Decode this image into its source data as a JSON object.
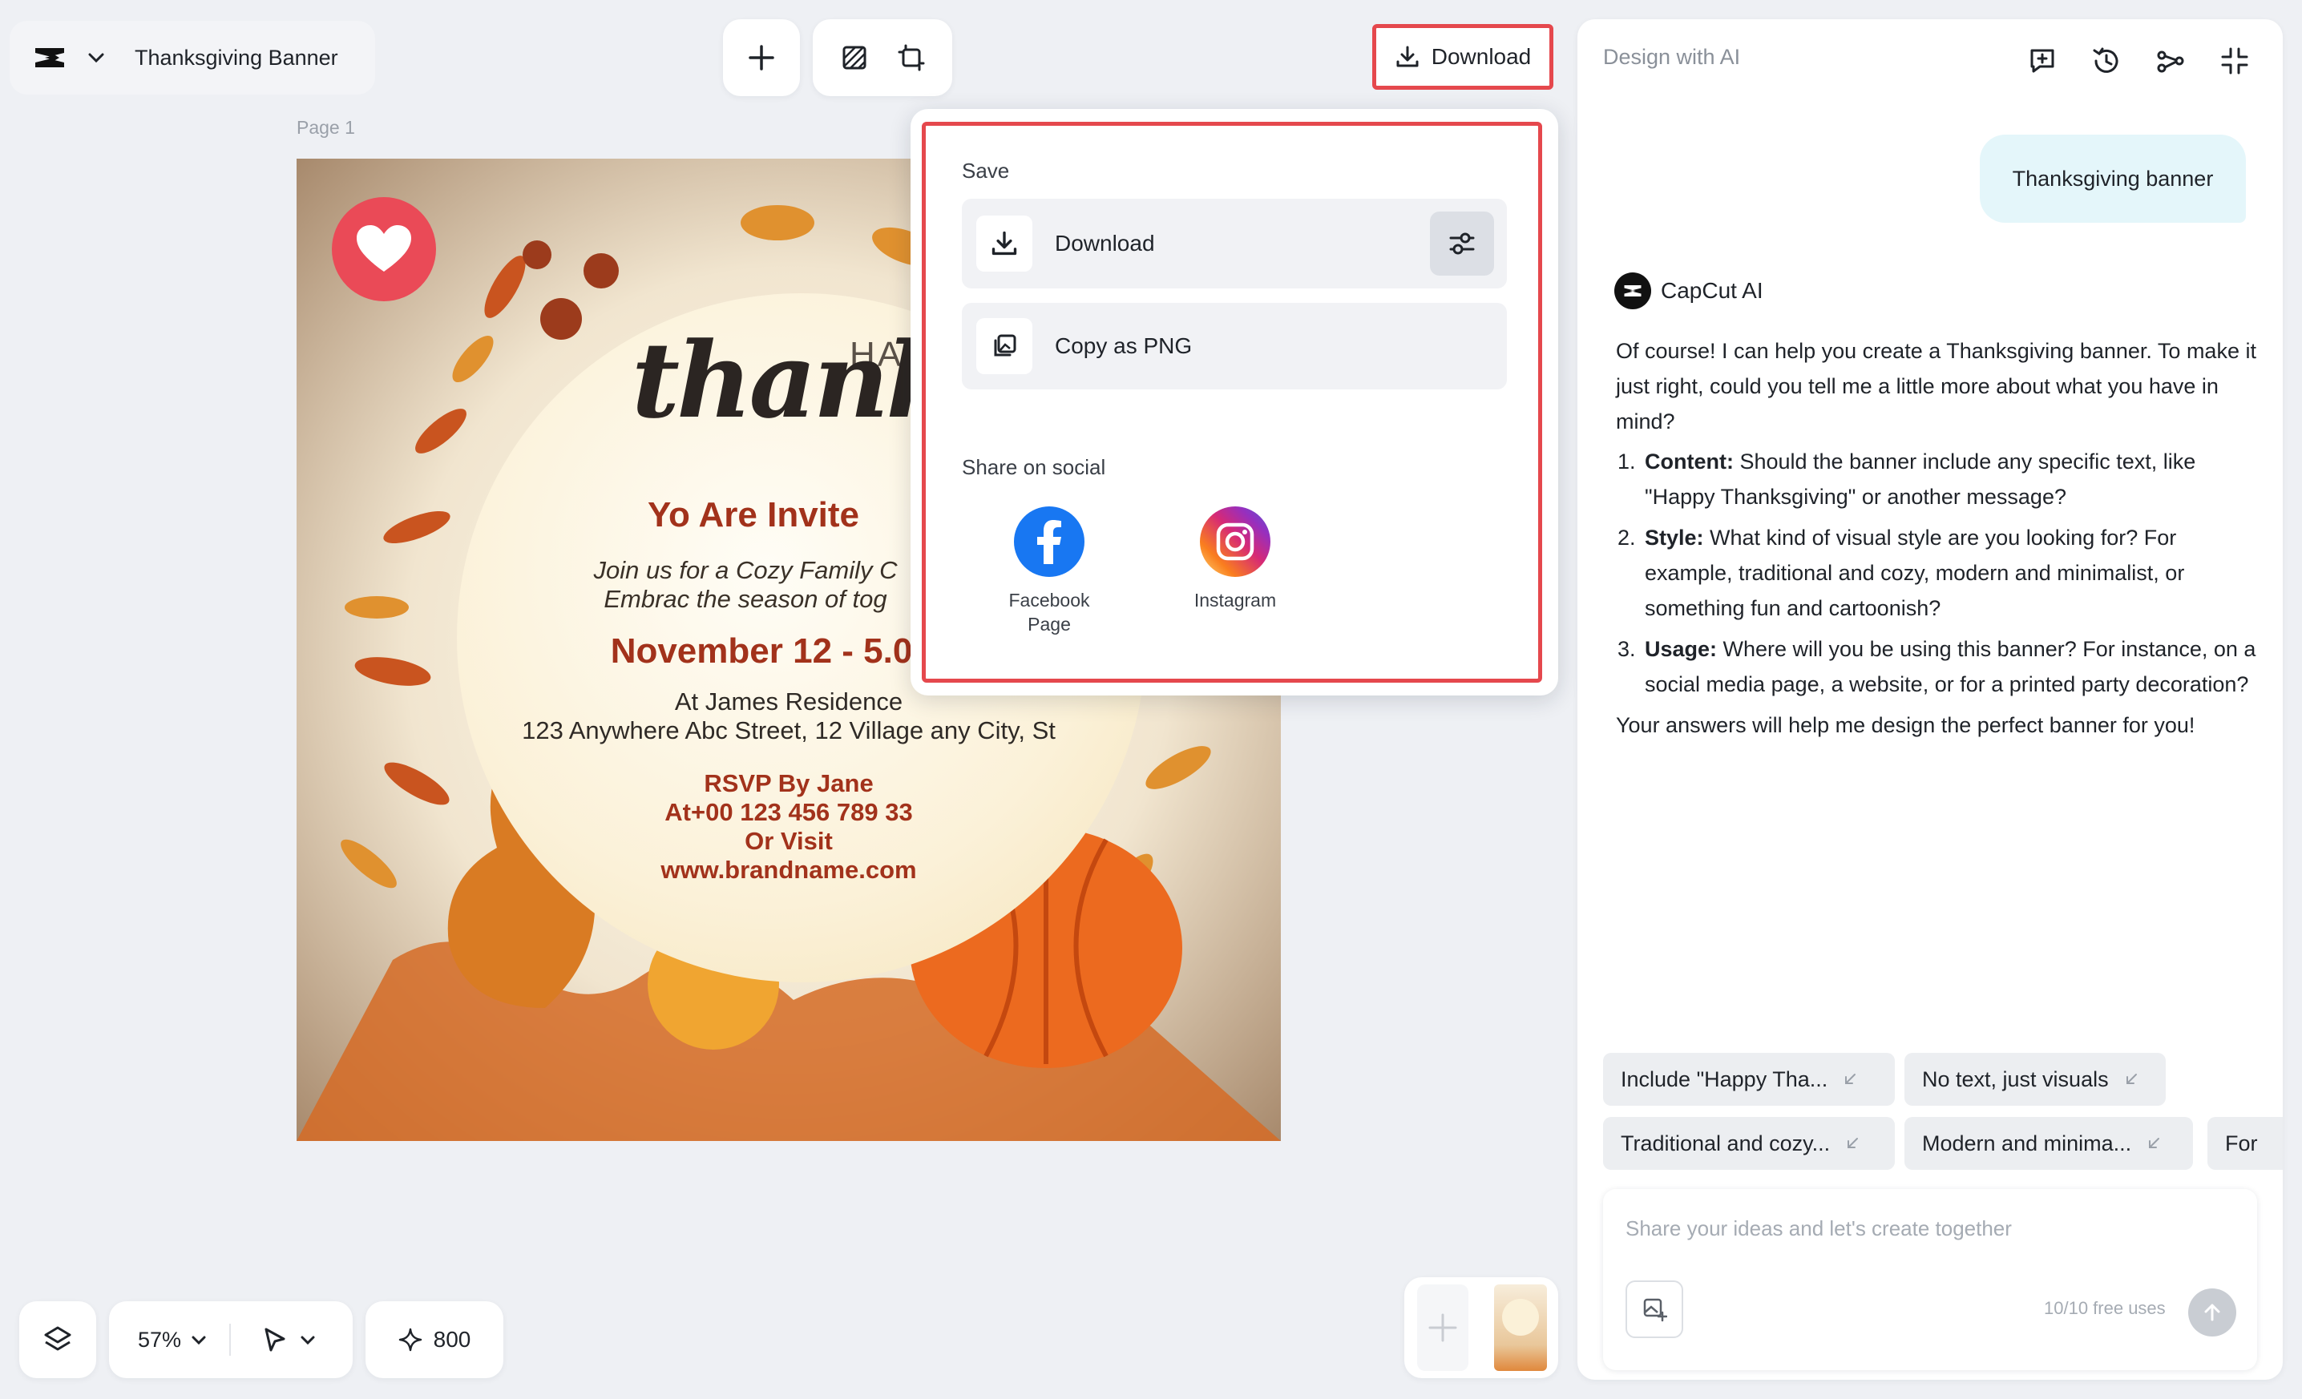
{
  "header": {
    "doc_title": "Thanksgiving Banner",
    "download_label": "Download"
  },
  "canvas": {
    "page_label": "Page 1",
    "invitation": {
      "happy": "HAP",
      "script": "thanksgivi",
      "invited": "Yo Are Invite",
      "join": "Join us for a Cozy Family C",
      "embrace": "Embrac the season of tog",
      "date": "November 12 - 5.0",
      "at": "At James Residence",
      "address": "123 Anywhere Abc Street, 12 Village any City, St",
      "rsvp": "RSVP By Jane",
      "tel": "At+00 123 456 789 33",
      "visit": "Or Visit",
      "web": "www.brandname.com"
    }
  },
  "download_menu": {
    "save_section": "Save",
    "download_item": "Download",
    "copy_item": "Copy as PNG",
    "share_section": "Share on social",
    "social": [
      {
        "label": "Facebook Page",
        "icon": "facebook-icon",
        "color": "#1877f2"
      },
      {
        "label": "Instagram",
        "icon": "instagram-icon"
      }
    ]
  },
  "bottom_bar": {
    "zoom": "57%",
    "credits": "800"
  },
  "ai_panel": {
    "title": "Design with AI",
    "user_message": "Thanksgiving banner",
    "assistant_name": "CapCut AI",
    "intro": "Of course! I can help you create a Thanksgiving banner. To make it just right, could you tell me a little more about what you have in mind?",
    "questions": [
      {
        "label": "Content:",
        "text": " Should the banner include any specific text, like \"Happy Thanksgiving\" or another message?"
      },
      {
        "label": "Style:",
        "text": " What kind of visual style are you looking for? For example, traditional and cozy, modern and minimalist, or something fun and cartoonish?"
      },
      {
        "label": "Usage:",
        "text": " Where will you be using this banner? For instance, on a social media page, a website, or for a printed party decoration?"
      }
    ],
    "outro": "Your answers will help me design the perfect banner for you!",
    "suggestions": [
      "Include \"Happy Tha...",
      "No text, just visuals",
      "Traditional and cozy...",
      "Modern and minima...",
      "For"
    ],
    "input_placeholder": "Share your ideas and let's create together",
    "free_uses": "10/10 free uses"
  },
  "colors": {
    "accent_highlight": "#e5484d",
    "user_bubble": "#e4f6fa",
    "heart_badge": "#ea4a57"
  }
}
